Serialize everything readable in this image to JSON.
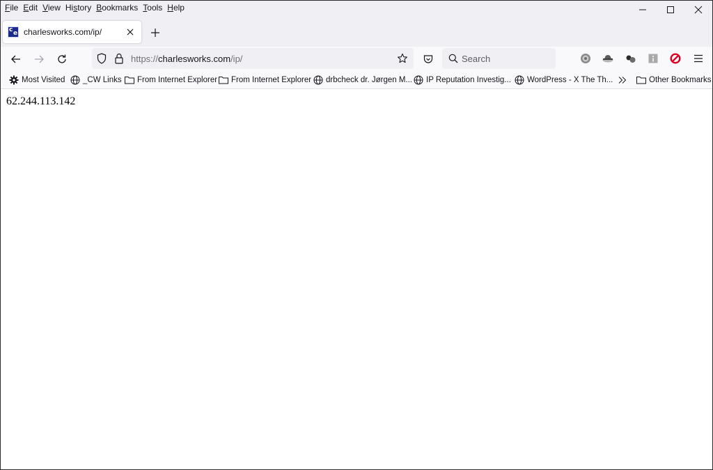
{
  "menu": {
    "items": [
      {
        "label": "File",
        "accel": "F"
      },
      {
        "label": "Edit",
        "accel": "E"
      },
      {
        "label": "View",
        "accel": "V"
      },
      {
        "label": "History",
        "accel": "s"
      },
      {
        "label": "Bookmarks",
        "accel": "B"
      },
      {
        "label": "Tools",
        "accel": "T"
      },
      {
        "label": "Help",
        "accel": "H"
      }
    ]
  },
  "window_controls": {
    "minimize": "minimize-icon",
    "maximize": "maximize-icon",
    "close": "close-icon"
  },
  "tabs": [
    {
      "title": "charlesworks.com/ip/",
      "favicon": "ce",
      "active": true
    }
  ],
  "navbar": {
    "url_prefix": "https://",
    "url_host": "charlesworks.com",
    "url_path": "/ip/",
    "search_placeholder": "Search"
  },
  "bookmarks": [
    {
      "label": "Most Visited",
      "icon": "gear-icon"
    },
    {
      "label": "_CW Links",
      "icon": "globe-icon"
    },
    {
      "label": "From Internet Explorer",
      "icon": "folder-icon"
    },
    {
      "label": "From Internet Explorer",
      "icon": "folder-icon"
    },
    {
      "label": "drbcheck dr. Jørgen M...",
      "icon": "globe-icon"
    },
    {
      "label": "IP Reputation Investig...",
      "icon": "globe-icon"
    },
    {
      "label": "WordPress - X  The Th...",
      "icon": "globe-icon"
    }
  ],
  "bookmarks_overflow": "»",
  "other_bookmarks": "Other Bookmarks",
  "content": {
    "ip_address": "62.244.113.142"
  },
  "colors": {
    "chrome_bg": "#f0f0f4",
    "toolbar_bg": "#f9f9fb",
    "favicon_bg": "#1b2a8f",
    "blocker_red": "#d70022"
  }
}
